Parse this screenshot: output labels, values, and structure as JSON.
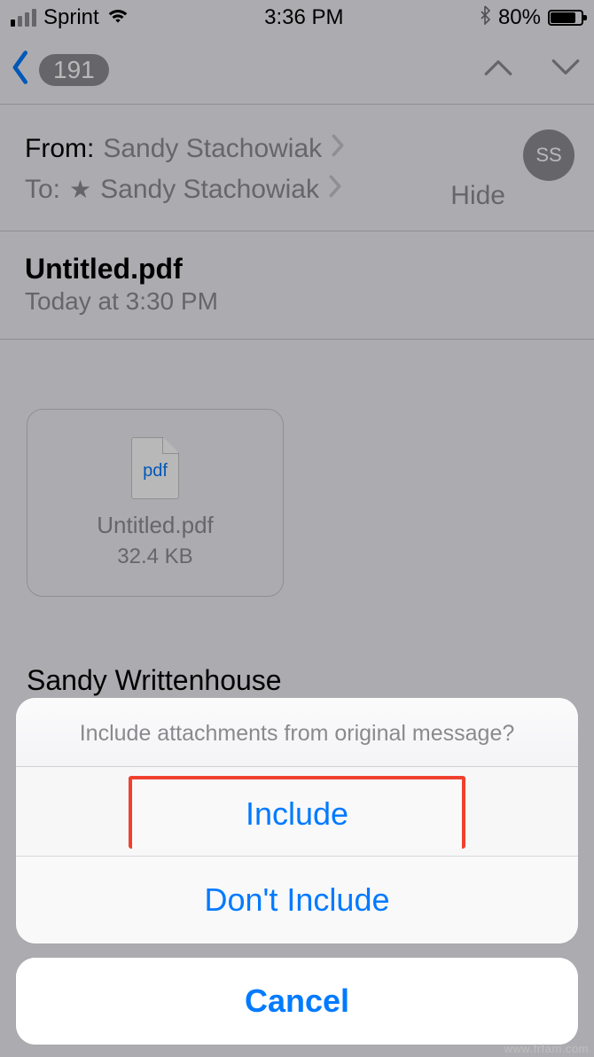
{
  "status_bar": {
    "carrier": "Sprint",
    "time": "3:36 PM",
    "battery_pct": "80%",
    "signal_active_bars": 1
  },
  "nav": {
    "back_count": "191"
  },
  "mail": {
    "from_label": "From:",
    "from_name": "Sandy Stachowiak",
    "to_label": "To:",
    "to_name": "Sandy Stachowiak",
    "hide_label": "Hide",
    "avatar_initials": "SS",
    "subject": "Untitled.pdf",
    "timestamp": "Today at 3:30 PM",
    "signature": "Sandy Writtenhouse"
  },
  "attachment": {
    "ext_label": "pdf",
    "filename": "Untitled.pdf",
    "size": "32.4 KB"
  },
  "action_sheet": {
    "message": "Include attachments from original message?",
    "include": "Include",
    "dont_include": "Don't Include",
    "cancel": "Cancel"
  },
  "watermark": "www.frfam.com"
}
